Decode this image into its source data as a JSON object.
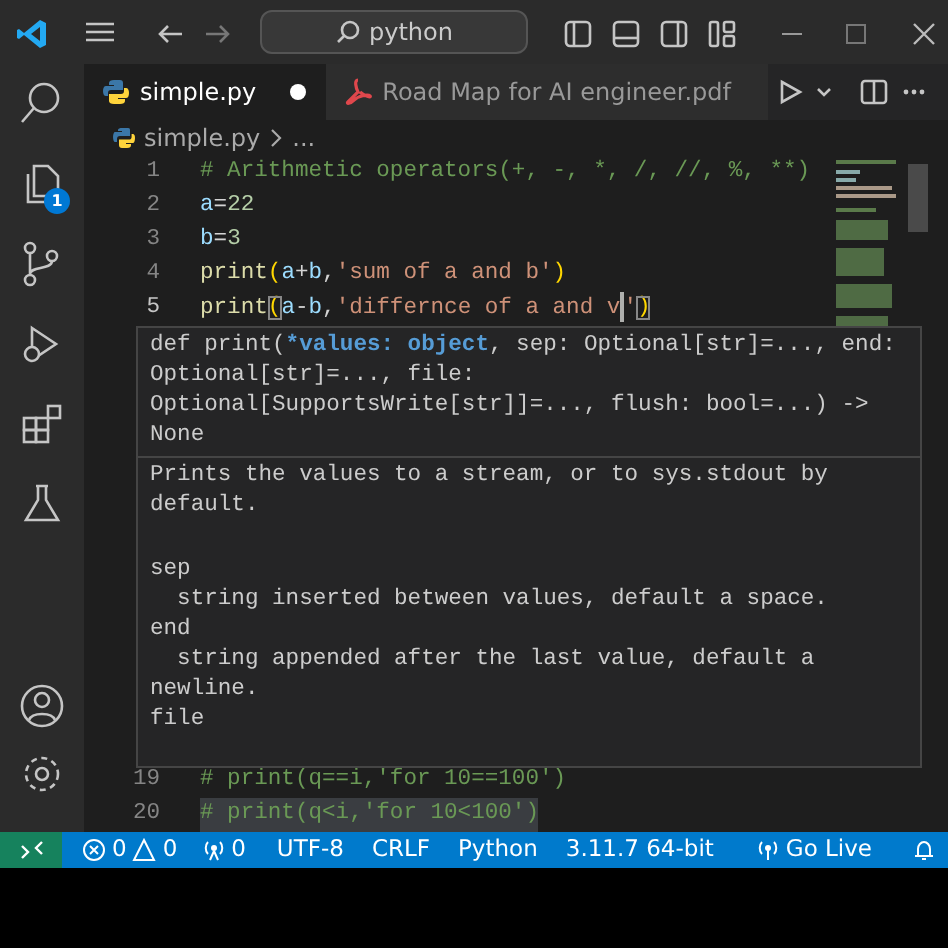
{
  "title_bar": {
    "search": "python"
  },
  "activity_bar": {
    "explorer_badge": "1"
  },
  "tabs": [
    {
      "label": "simple.py",
      "kind": "python",
      "selected": true,
      "dirty": true
    },
    {
      "label": "Road Map for AI engineer.pdf",
      "kind": "pdf",
      "selected": false,
      "dirty": false
    }
  ],
  "breadcrumb": [
    "simple.py",
    "..."
  ],
  "editor": {
    "lines": [
      {
        "number": "1",
        "current": false,
        "highlight": false,
        "tokens": [
          {
            "text": "# Arithmetic operators(+, -, *, /, //, %, **)",
            "kind": "comment"
          }
        ]
      },
      {
        "number": "2",
        "current": false,
        "highlight": false,
        "tokens": [
          {
            "text": "a",
            "kind": "var"
          },
          {
            "text": "=",
            "kind": "op"
          },
          {
            "text": "22",
            "kind": "number"
          }
        ]
      },
      {
        "number": "3",
        "current": false,
        "highlight": false,
        "tokens": [
          {
            "text": "b",
            "kind": "var"
          },
          {
            "text": "=",
            "kind": "op"
          },
          {
            "text": "3",
            "kind": "number"
          }
        ]
      },
      {
        "number": "4",
        "current": false,
        "highlight": false,
        "tokens": [
          {
            "text": "print",
            "kind": "func"
          },
          {
            "text": "(",
            "kind": "bracket"
          },
          {
            "text": "a",
            "kind": "var"
          },
          {
            "text": "+",
            "kind": "op"
          },
          {
            "text": "b",
            "kind": "var"
          },
          {
            "text": ",",
            "kind": "op"
          },
          {
            "text": "'sum of a and b'",
            "kind": "string"
          },
          {
            "text": ")",
            "kind": "bracket"
          }
        ]
      },
      {
        "number": "5",
        "current": true,
        "highlight": false,
        "tokens": [
          {
            "text": "print",
            "kind": "func"
          },
          {
            "text": "(",
            "kind": "bracket-match"
          },
          {
            "text": "a",
            "kind": "var"
          },
          {
            "text": "-",
            "kind": "op"
          },
          {
            "text": "b",
            "kind": "var"
          },
          {
            "text": ",",
            "kind": "op"
          },
          {
            "text": "'differnce of a and v",
            "kind": "string"
          },
          {
            "text": "'",
            "kind": "string",
            "cursor_before": true
          },
          {
            "text": ")",
            "kind": "bracket-match"
          }
        ]
      },
      {
        "number": "19",
        "current": false,
        "highlight": false,
        "tokens": [
          {
            "text": "# print(q==i,'for 10==100')",
            "kind": "comment"
          }
        ]
      },
      {
        "number": "20",
        "current": false,
        "highlight": true,
        "tokens": [
          {
            "text": "# print(q<i,'for 10<100')",
            "kind": "comment"
          }
        ]
      }
    ]
  },
  "hover": {
    "signature": [
      [
        {
          "text": "def print(",
          "kind": "plain"
        },
        {
          "text": "*values: object",
          "kind": "param"
        },
        {
          "text": ", sep: Optional[str]=..., end:",
          "kind": "plain"
        }
      ],
      [
        {
          "text": "Optional[str]=..., file:",
          "kind": "plain"
        }
      ],
      [
        {
          "text": "Optional[SupportsWrite[str]]=..., flush: bool=...) ->",
          "kind": "plain"
        }
      ],
      [
        {
          "text": "None",
          "kind": "plain"
        }
      ]
    ],
    "doc": [
      {
        "kind": "para",
        "lines": [
          "Prints the values to a stream, or to sys.stdout by",
          "default."
        ]
      },
      {
        "kind": "param",
        "name": "sep",
        "lines": [
          "  string inserted between values, default a space."
        ]
      },
      {
        "kind": "param",
        "name": "end",
        "lines": [
          "  string appended after the last value, default a",
          "newline."
        ]
      },
      {
        "kind": "param",
        "name": "file"
      }
    ]
  },
  "status_bar": {
    "errors": "0",
    "warnings": "0",
    "ports": "0",
    "items": [
      "UTF-8",
      "CRLF",
      "Python",
      "3.11.7 64-bit"
    ],
    "go_live": "Go Live"
  }
}
